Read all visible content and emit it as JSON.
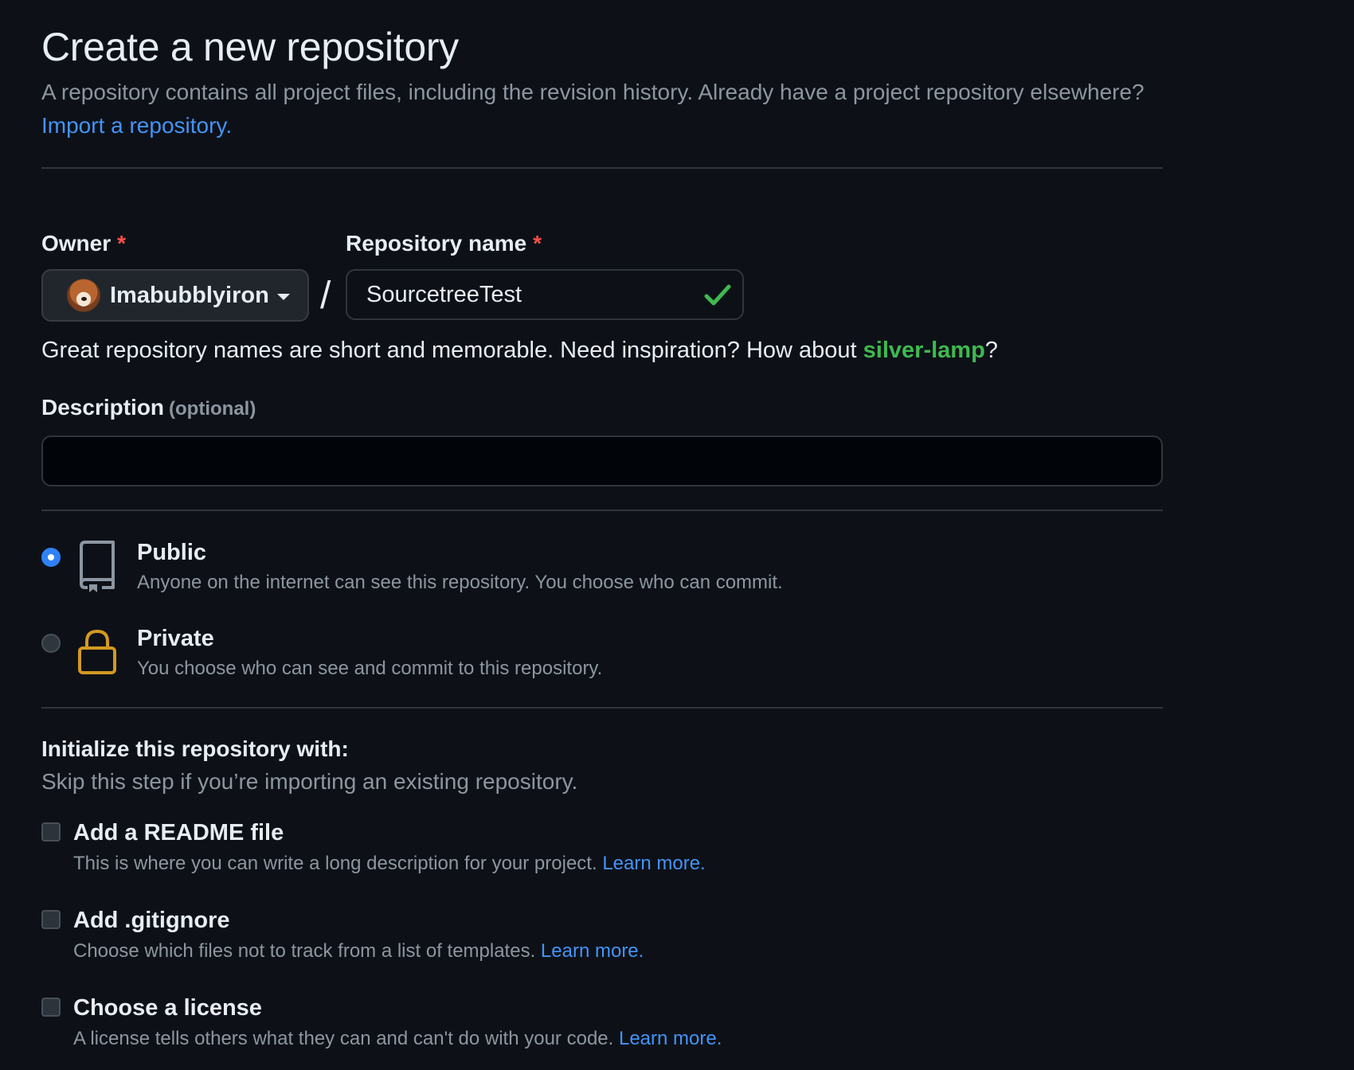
{
  "header": {
    "title": "Create a new repository",
    "intro_text": "A repository contains all project files, including the revision history. Already have a project repository elsewhere?",
    "import_link": "Import a repository."
  },
  "owner": {
    "label": "Owner",
    "required_mark": "*",
    "selected": "Imabubblyiron"
  },
  "separator": "/",
  "repo_name": {
    "label": "Repository name",
    "required_mark": "*",
    "value": "SourcetreeTest",
    "valid": true
  },
  "name_hint": {
    "text": "Great repository names are short and memorable. Need inspiration? How about",
    "suggestion": "silver-lamp",
    "trailing": "?"
  },
  "description": {
    "label": "Description",
    "optional_text": "(optional)",
    "value": ""
  },
  "visibility": {
    "selected": "public",
    "options": [
      {
        "title": "Public",
        "description": "Anyone on the internet can see this repository. You choose who can commit.",
        "icon": "repo-icon"
      },
      {
        "title": "Private",
        "description": "You choose who can see and commit to this repository.",
        "icon": "lock-icon"
      }
    ]
  },
  "initialize": {
    "title": "Initialize this repository with:",
    "subtitle": "Skip this step if you’re importing an existing repository.",
    "options": [
      {
        "title": "Add a README file",
        "description": "This is where you can write a long description for your project.",
        "link": "Learn more.",
        "checked": false
      },
      {
        "title": "Add .gitignore",
        "description": "Choose which files not to track from a list of templates.",
        "link": "Learn more.",
        "checked": false
      },
      {
        "title": "Choose a license",
        "description": "A license tells others what they can and can't do with your code.",
        "link": "Learn more.",
        "checked": false
      }
    ]
  },
  "colors": {
    "background": "#0d1117",
    "link": "#4493f8",
    "success": "#3fb950",
    "required": "#f85149",
    "radio_selected": "#2f81f7",
    "lock_icon": "#d29922"
  }
}
